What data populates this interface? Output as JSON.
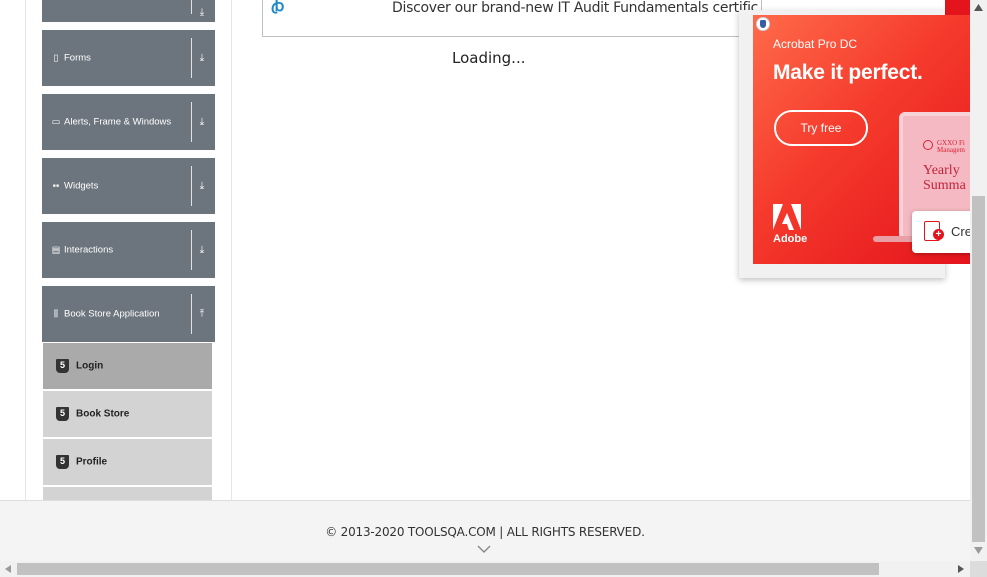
{
  "sidebar": {
    "groups": [
      {
        "label": "",
        "icon": "",
        "arrow": "download-arrow-icon"
      },
      {
        "label": "Forms",
        "icon": "document-icon",
        "arrow": "download-arrow-icon"
      },
      {
        "label": "Alerts, Frame & Windows",
        "icon": "window-icon",
        "arrow": "download-arrow-icon"
      },
      {
        "label": "Widgets",
        "icon": "grid-icon",
        "arrow": "download-arrow-icon"
      },
      {
        "label": "Interactions",
        "icon": "list-icon",
        "arrow": "download-arrow-icon"
      },
      {
        "label": "Book Store Application",
        "icon": "books-icon",
        "arrow": "upload-arrow-icon",
        "expanded": true
      }
    ],
    "book_store_items": [
      {
        "label": "Login",
        "icon": "html5-icon",
        "active": true
      },
      {
        "label": "Book Store",
        "icon": "html5-icon",
        "active": false
      },
      {
        "label": "Profile",
        "icon": "html5-icon",
        "active": false
      },
      {
        "label": "",
        "icon": "",
        "active": false
      }
    ]
  },
  "main": {
    "banner_text": "Discover our brand-new IT Audit Fundamentals certific",
    "loading_text": "Loading..."
  },
  "ad": {
    "product": "Acrobat Pro DC",
    "headline": "Make it perfect.",
    "cta": "Try free",
    "brand": "Adobe",
    "laptop_brand": "GXXO Fi Managem",
    "laptop_title_line1": "Yearly",
    "laptop_title_line2": "Summa",
    "create_label": "Cre",
    "colors": {
      "primary": "#e4141c",
      "light": "#ff6b4a"
    }
  },
  "footer": {
    "copyright": "© 2013-2020 TOOLSQA.COM | ALL RIGHTS RESERVED."
  },
  "colors": {
    "sidebar_header": "#6c757d",
    "sub_item": "#d3d3d3",
    "sub_item_active": "#aaaaaa",
    "footer_bg": "#f4f4f4"
  }
}
